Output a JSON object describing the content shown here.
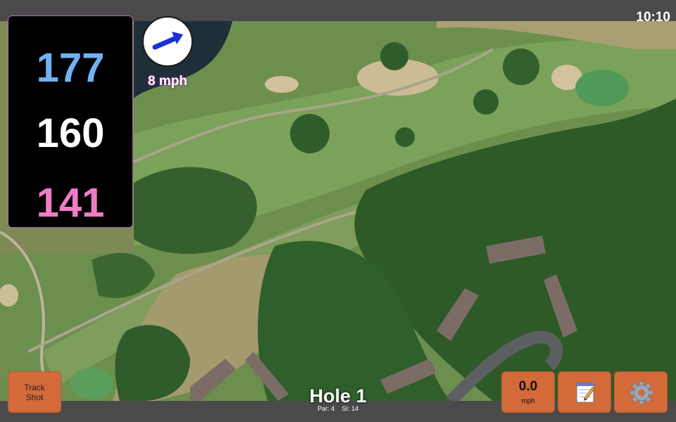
{
  "status_bar": {
    "time": "10:10"
  },
  "distances": {
    "back": "177",
    "middle": "160",
    "front": "141"
  },
  "wind": {
    "speed_label": "8 mph",
    "icon": "wind-arrow-icon"
  },
  "buttons": {
    "track_shot_line1": "Track",
    "track_shot_line2": "Shot",
    "speed_value": "0.0",
    "speed_unit": "mph",
    "notes_icon": "notepad-icon",
    "settings_icon": "gear-icon"
  },
  "hole": {
    "title": "Hole 1",
    "par": "Par: 4",
    "stroke_index": "SI: 14"
  },
  "colors": {
    "back": "#6fb2f2",
    "middle": "#ffffff",
    "front": "#f07cc6",
    "button": "#d46a3a",
    "bar": "#4a4a4a"
  }
}
